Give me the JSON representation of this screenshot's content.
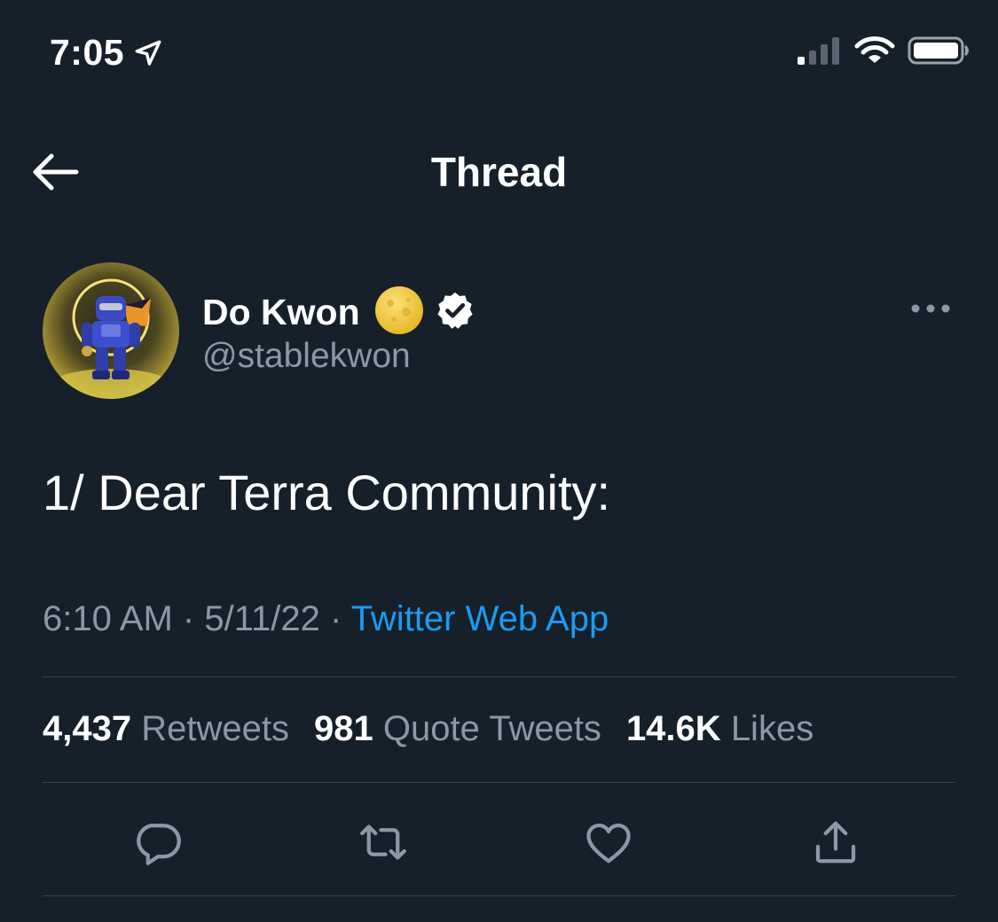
{
  "status_bar": {
    "time": "7:05",
    "location_icon": "location-arrow-icon",
    "signal_icon": "cellular-signal-icon",
    "wifi_icon": "wifi-icon",
    "battery_icon": "battery-icon"
  },
  "header": {
    "back_icon": "back-arrow-icon",
    "title": "Thread"
  },
  "tweet": {
    "author": {
      "display_name": "Do Kwon",
      "emoji_icon": "full-moon-emoji-icon",
      "verified_icon": "verified-badge-icon",
      "handle": "@stablekwon",
      "avatar_icon": "avatar-robot-icon"
    },
    "more_icon": "more-options-icon",
    "text": "1/ Dear Terra Community:",
    "time": "6:10 AM",
    "separator": "·",
    "date": "5/11/22",
    "source": "Twitter Web App",
    "stats": {
      "retweets_count": "4,437",
      "retweets_label": "Retweets",
      "quotes_count": "981",
      "quotes_label": "Quote Tweets",
      "likes_count": "14.6K",
      "likes_label": "Likes"
    },
    "actions": [
      "reply-icon",
      "retweet-icon",
      "like-icon",
      "share-icon"
    ]
  },
  "colors": {
    "background": "#15202b",
    "text_primary": "#ffffff",
    "text_secondary": "#8b98a5",
    "link": "#1d9bf0",
    "divider": "#38444d"
  }
}
